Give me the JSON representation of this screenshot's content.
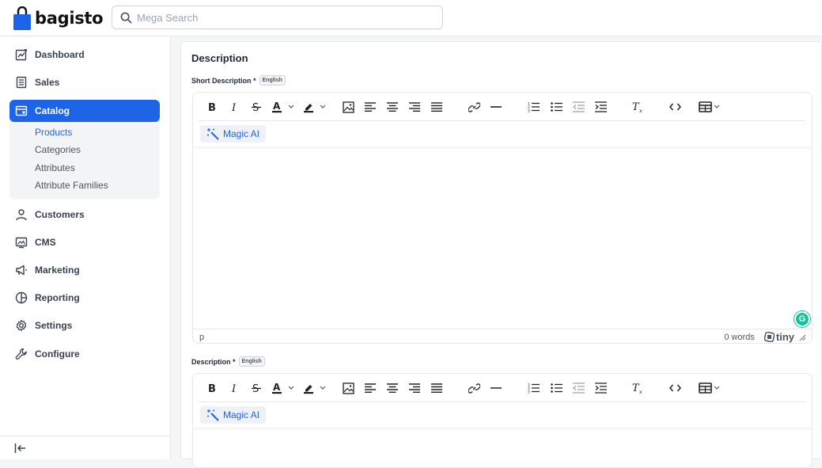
{
  "brand": {
    "name": "bagisto"
  },
  "search": {
    "placeholder": "Mega Search"
  },
  "sidebar": {
    "items": [
      {
        "label": "Dashboard"
      },
      {
        "label": "Sales"
      },
      {
        "label": "Catalog"
      },
      {
        "label": "Customers"
      },
      {
        "label": "CMS"
      },
      {
        "label": "Marketing"
      },
      {
        "label": "Reporting"
      },
      {
        "label": "Settings"
      },
      {
        "label": "Configure"
      }
    ],
    "catalog_children": [
      {
        "label": "Products"
      },
      {
        "label": "Categories"
      },
      {
        "label": "Attributes"
      },
      {
        "label": "Attribute Families"
      }
    ]
  },
  "content": {
    "section_title": "Description",
    "short_description": {
      "label": "Short Description *",
      "locale": "English",
      "magic_label": "Magic AI",
      "path": "p",
      "word_count": "0 words",
      "tiny_label": "tiny"
    },
    "description": {
      "label": "Description *",
      "locale": "English",
      "magic_label": "Magic AI"
    }
  },
  "colors": {
    "accent": "#1d64e6",
    "grammarly": "#15c39a"
  }
}
